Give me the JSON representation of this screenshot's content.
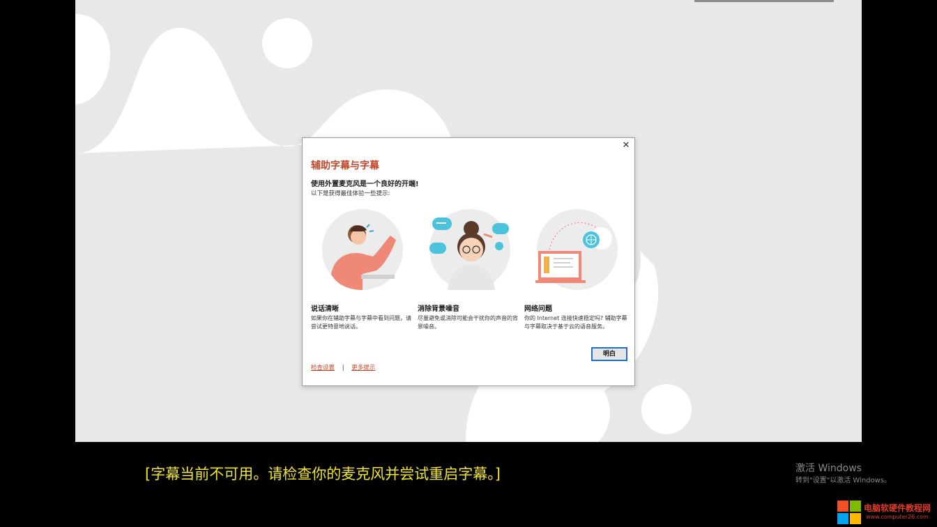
{
  "colors": {
    "accent": "#c0462a",
    "caption": "#f0e532",
    "slide_bg": "#e8e8e8",
    "button_border": "#1f6fd1"
  },
  "dialog": {
    "title": "辅助字幕与字幕",
    "subtitle": "使用外置麦克风是一个良好的开端!",
    "intro": "以下是获得最佳体验一些提示:",
    "close_icon": "close-icon",
    "tips": [
      {
        "heading": "说话清晰",
        "body": "如果你在辅助字幕与字幕中看到问题，请尝试更特意地说话。",
        "icon": "speaking-person-illustration"
      },
      {
        "heading": "消除背景噪音",
        "body": "尽量避免或消除可能会干扰你的声音的背景噪音。",
        "icon": "thinking-woman-illustration"
      },
      {
        "heading": "网络问题",
        "body": "你的 Internet 连接快速稳定吗? 辅助字幕与字幕取决于基于云的语音服务。",
        "icon": "laptop-globe-illustration"
      }
    ],
    "ok_label": "明白",
    "link_settings": "检查设置",
    "link_separator": "|",
    "link_more": "更多提示"
  },
  "caption": "[字幕当前不可用。请检查你的麦克风并尝试重启字幕。]",
  "watermark": {
    "title": "激活 Windows",
    "hint": "转到\"设置\"以激活 Windows。"
  },
  "site": {
    "name": "电脑软硬件教程网",
    "url": "www.computer26.com"
  }
}
